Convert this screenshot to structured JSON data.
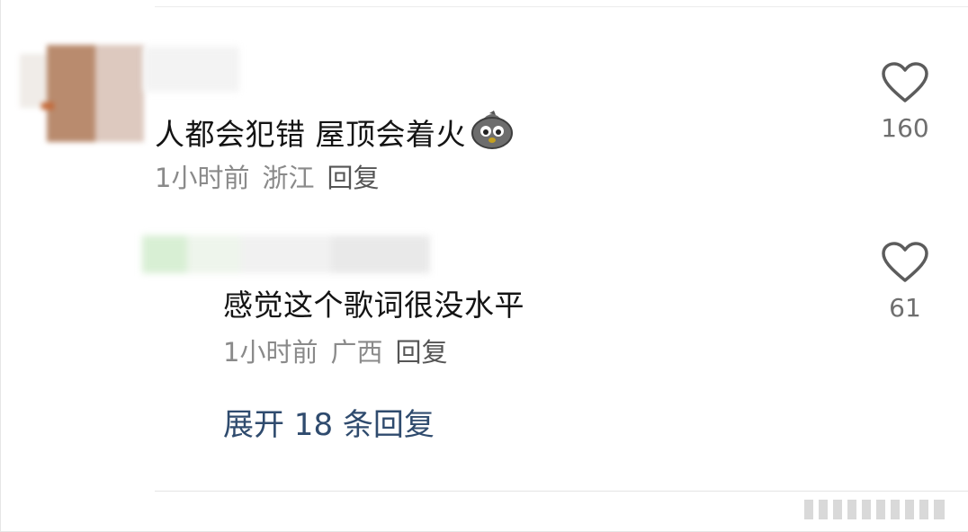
{
  "comments": [
    {
      "text": "人都会犯错 屋顶会着火",
      "emoji": "shocked-bird-emoji",
      "time": "1小时前",
      "location": "浙江",
      "reply_label": "回复",
      "likes": "160"
    },
    {
      "text": "感觉这个歌词很没水平",
      "time": "1小时前",
      "location": "广西",
      "reply_label": "回复",
      "likes": "61"
    }
  ],
  "expand_replies": "展开 18 条回复",
  "colors": {
    "text_primary": "#141414",
    "text_meta": "#8a8a8a",
    "link_blue": "#2f4b6e",
    "icon_gray": "#6f6f6f"
  },
  "icons": [
    "heart-icon"
  ]
}
